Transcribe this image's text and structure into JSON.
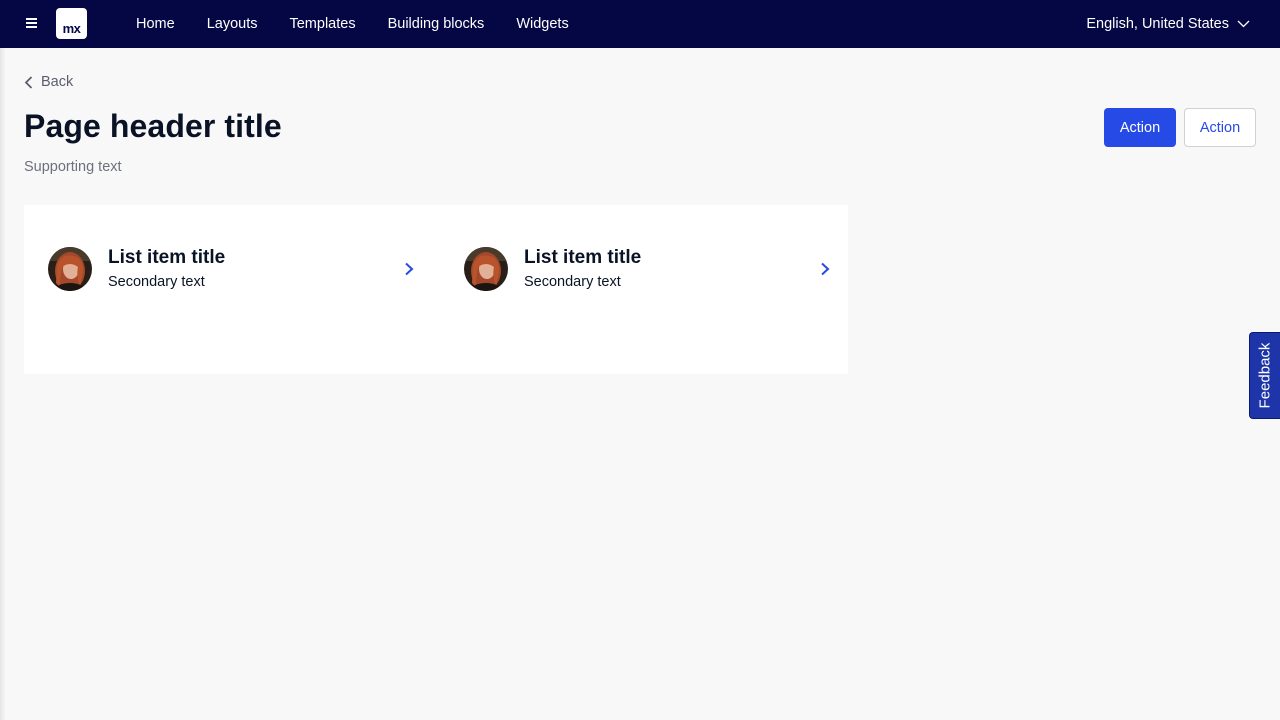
{
  "topbar": {
    "logo_text": "mx",
    "nav": [
      "Home",
      "Layouts",
      "Templates",
      "Building blocks",
      "Widgets"
    ],
    "language": "English, United States"
  },
  "back_label": "Back",
  "header": {
    "title": "Page header title",
    "supporting_text": "Supporting text",
    "primary_action": "Action",
    "secondary_action": "Action"
  },
  "list_items": [
    {
      "title": "List item title",
      "secondary": "Secondary text"
    },
    {
      "title": "List item title",
      "secondary": "Secondary text"
    }
  ],
  "feedback_label": "Feedback",
  "colors": {
    "topbar": "#040744",
    "primary": "#264ae5",
    "background": "#f8f8f8",
    "feedback": "#1d35a8"
  },
  "icons": [
    "hamburger-menu-icon",
    "chevron-down-icon",
    "chevron-left-icon",
    "chevron-right-icon"
  ]
}
